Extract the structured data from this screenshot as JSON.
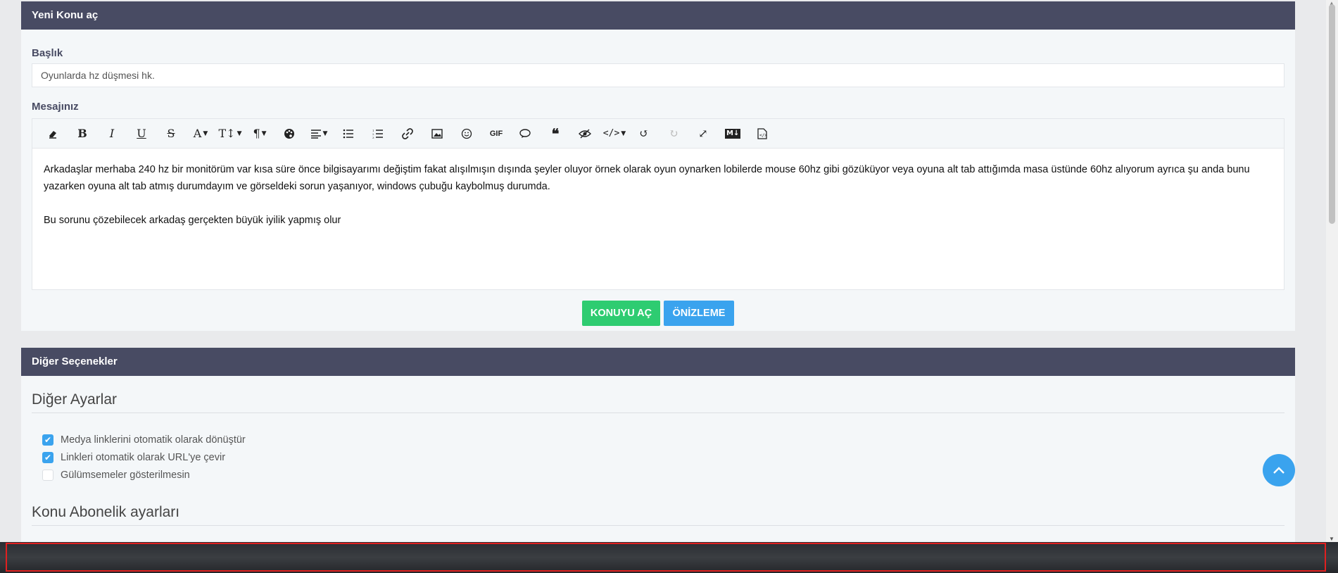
{
  "new_topic": {
    "header": "Yeni Konu aç",
    "title_label": "Başlık",
    "title_value": "Oyunlarda hz düşmesi hk.",
    "message_label": "Mesajınız",
    "toolbar": [
      "eraser-icon",
      "bold-icon",
      "italic-icon",
      "underline-icon",
      "strikethrough-icon",
      "font-icon",
      "font-size-icon",
      "paragraph-icon",
      "palette-icon",
      "align-icon",
      "bullet-list-icon",
      "numbered-list-icon",
      "link-icon",
      "image-icon",
      "emoji-icon",
      "gif-icon",
      "quote-bubble-icon",
      "blockquote-icon",
      "hide-icon",
      "code-icon",
      "undo-icon",
      "redo-icon",
      "fullscreen-icon",
      "markdown-icon",
      "source-icon"
    ],
    "toolbar_gif_label": "GIF",
    "toolbar_md_label": "M↓",
    "message_para1": "Arkadaşlar merhaba 240 hz bir monitörüm var kısa süre önce bilgisayarımı değiştim fakat alışılmışın dışında şeyler oluyor örnek olarak oyun oynarken lobilerde mouse 60hz gibi gözüküyor veya oyuna alt tab attığımda masa üstünde 60hz alıyorum ayrıca şu anda bunu yazarken oyuna alt tab atmış durumdayım ve görseldeki sorun yaşanıyor, windows çubuğu kaybolmuş durumda.",
    "message_para2": "Bu sorunu çözebilecek arkadaş gerçekten büyük iyilik yapmış olur",
    "submit_label": "KONUYU AÇ",
    "preview_label": "ÖNİZLEME"
  },
  "other_options": {
    "header": "Diğer Seçenekler",
    "settings_title": "Diğer Ayarlar",
    "checks": [
      {
        "label": "Medya linklerini otomatik olarak dönüştür",
        "checked": true
      },
      {
        "label": "Linkleri otomatik olarak URL'ye çevir",
        "checked": true
      },
      {
        "label": "Gülümsemeler gösterilmesin",
        "checked": false
      }
    ],
    "subscription_title": "Konu Abonelik ayarları"
  },
  "colors": {
    "header_bg": "#484b63",
    "green": "#2ecc71",
    "blue": "#3aa3ee"
  }
}
